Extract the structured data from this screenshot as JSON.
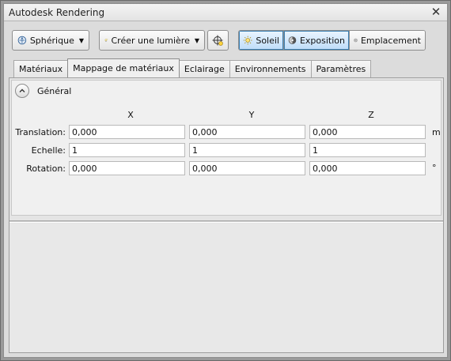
{
  "window": {
    "title": "Autodesk Rendering"
  },
  "toolbar": {
    "spherique": "Sphérique",
    "creer_lumiere": "Créer une lumière",
    "soleil": "Soleil",
    "exposition": "Exposition",
    "emplacement": "Emplacement"
  },
  "tabs": [
    {
      "label": "Matériaux"
    },
    {
      "label": "Mappage de matériaux",
      "active": true
    },
    {
      "label": "Eclairage"
    },
    {
      "label": "Environnements"
    },
    {
      "label": "Paramètres"
    }
  ],
  "section": {
    "title": "Général",
    "columns": [
      "X",
      "Y",
      "Z"
    ],
    "rows": [
      {
        "label": "Translation:",
        "values": [
          "0,000",
          "0,000",
          "0,000"
        ],
        "unit": "m"
      },
      {
        "label": "Echelle:",
        "values": [
          "1",
          "1",
          "1"
        ],
        "unit": ""
      },
      {
        "label": "Rotation:",
        "values": [
          "0,000",
          "0,000",
          "0,000"
        ],
        "unit": "°"
      }
    ]
  },
  "colors": {
    "active_blue": "#3c7fb1",
    "panel_bg": "#f0f0f0"
  }
}
